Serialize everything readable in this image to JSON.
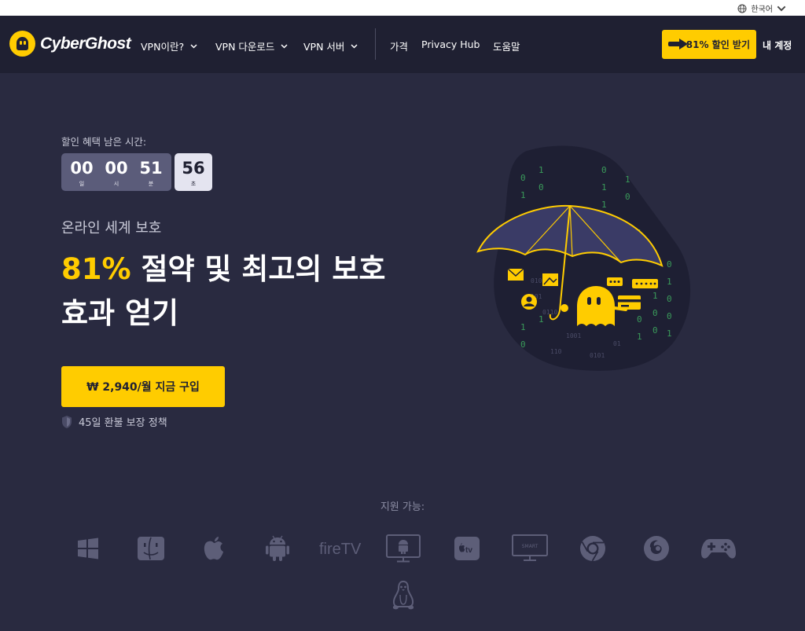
{
  "topbar": {
    "language": "한국어"
  },
  "nav": {
    "logo_text": "CyberGhost",
    "items": [
      {
        "label": "VPN이란?",
        "dropdown": true
      },
      {
        "label": "VPN 다운로드",
        "dropdown": true
      },
      {
        "label": "VPN 서버",
        "dropdown": true
      },
      {
        "label": "가격",
        "dropdown": false
      },
      {
        "label": "Privacy Hub",
        "dropdown": false
      },
      {
        "label": "도움말",
        "dropdown": false
      }
    ],
    "cta_label": "81% 할인 받기",
    "account_label": "내 계정"
  },
  "hero": {
    "timer_label": "할인 혜택 남은 시간:",
    "timer": [
      {
        "value": "00",
        "unit": "일"
      },
      {
        "value": "00",
        "unit": "시"
      },
      {
        "value": "51",
        "unit": "분"
      }
    ],
    "seconds": {
      "value": "56",
      "unit": "초"
    },
    "subheading": "온라인 세계 보호",
    "headline_highlight": "81%",
    "headline_line1": " 절약 및 최고의 보호",
    "headline_line2": "효과 얻기",
    "buy_label": "₩ 2,940/월 지금 구입",
    "refund_label": "45일 환불 보장 정책"
  },
  "platforms": {
    "label": "지원 가능:",
    "items": [
      "windows-icon",
      "macos-finder-icon",
      "apple-icon",
      "android-icon",
      "fire-tv-icon",
      "android-tv-icon",
      "apple-tv-icon",
      "smart-tv-icon",
      "chrome-icon",
      "firefox-icon",
      "gamepad-icon",
      "linux-icon"
    ],
    "firetv_text": "fireTV",
    "appletv_text": "tv",
    "smarttv_text": "SMART"
  },
  "colors": {
    "accent": "#ffcc00",
    "background": "#292a40",
    "nav": "#1f2032",
    "icon": "#5d5e78"
  }
}
